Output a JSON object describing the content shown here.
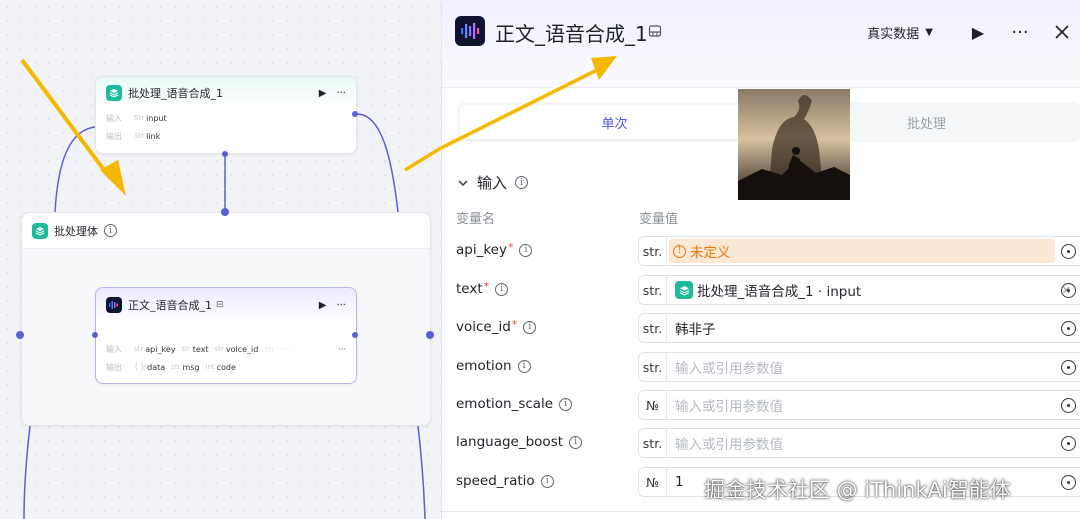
{
  "canvas": {
    "node1": {
      "title": "批处理_语音合成_1",
      "input_label": "输入",
      "output_label": "输出",
      "input_tag": "input",
      "output_tag": "link"
    },
    "batch": {
      "title": "批处理体"
    },
    "node2": {
      "title": "正文_语音合成_1",
      "input_label": "输入",
      "output_label": "输出",
      "inputs": [
        "api_key",
        "text",
        "voice_id"
      ],
      "outputs": [
        "data",
        "msg",
        "code"
      ],
      "more": "···"
    },
    "accent_color": "#5b5fd6",
    "arrow_color": "#f5b800"
  },
  "panel": {
    "title": "正文_语音合成_1",
    "data_select": "真实数据",
    "tabs": [
      {
        "label": "单次"
      },
      {
        "label": "批处理"
      }
    ],
    "section_title": "输入",
    "col_name": "变量名",
    "col_value": "变量值",
    "params": [
      {
        "name": "api_key",
        "required": "*",
        "type": "str.",
        "value": "未定义"
      },
      {
        "name": "text",
        "required": "*",
        "type": "str.",
        "value": "批处理_语音合成_1 · input"
      },
      {
        "name": "voice_id",
        "required": "*",
        "type": "str.",
        "value": "韩非子"
      },
      {
        "name": "emotion",
        "required": "",
        "type": "str.",
        "placeholder": "输入或引用参数值"
      },
      {
        "name": "emotion_scale",
        "required": "",
        "type": "№",
        "placeholder": "输入或引用参数值"
      },
      {
        "name": "language_boost",
        "required": "",
        "type": "str.",
        "placeholder": "输入或引用参数值"
      },
      {
        "name": "speed_ratio",
        "required": "",
        "type": "№",
        "value": "1"
      }
    ]
  },
  "watermark": "掘金技术社区 @ iThinkAi智能体"
}
